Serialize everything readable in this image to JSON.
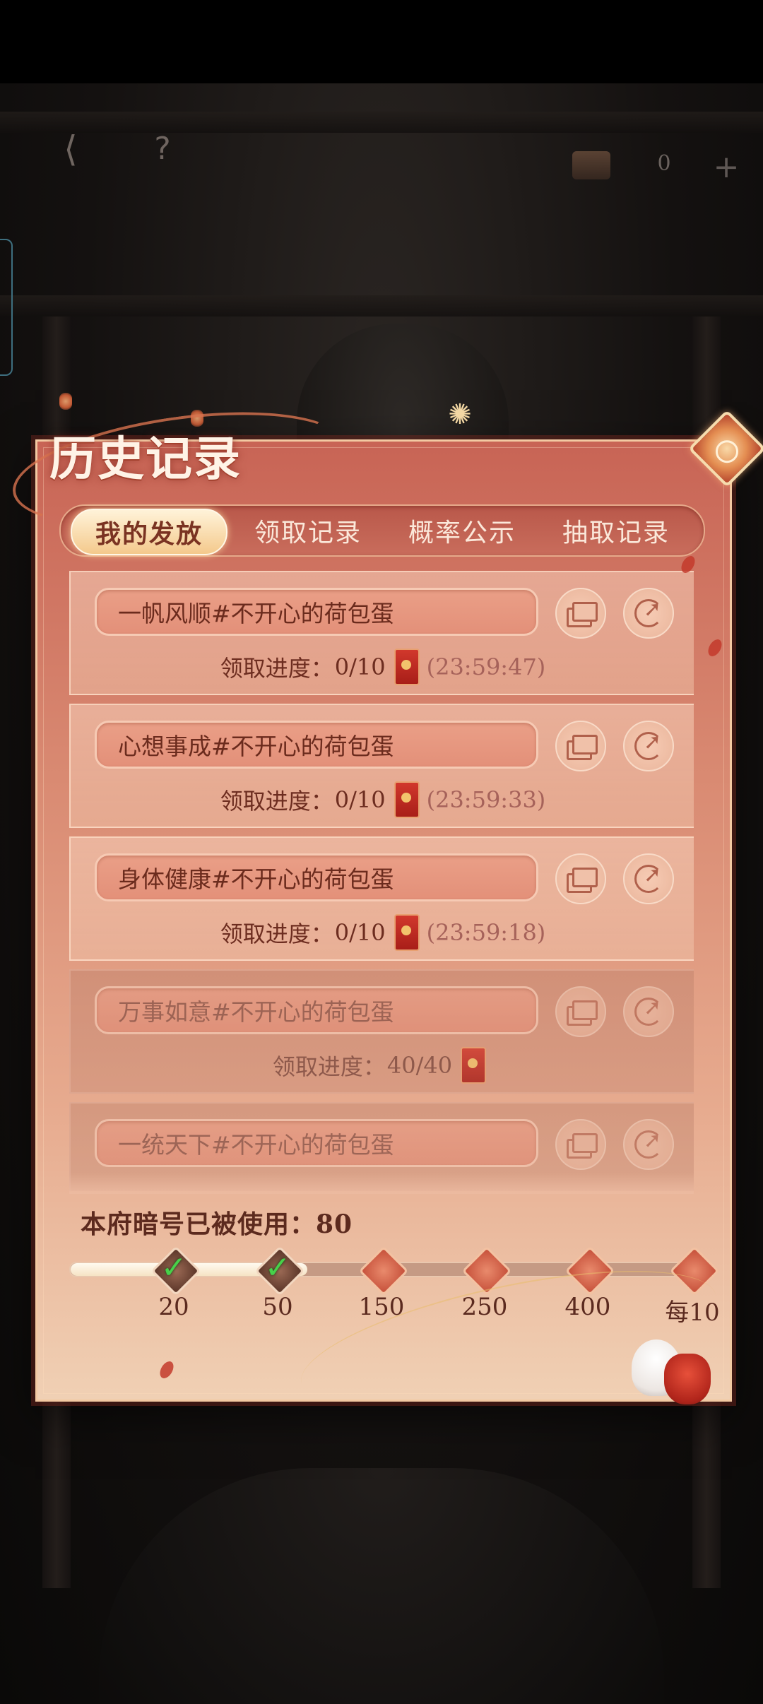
{
  "hud": {
    "back_icon": "back-arrow-icon",
    "help_label": "?",
    "currency_value": "0",
    "plus_label": "+"
  },
  "panel": {
    "title": "历史记录"
  },
  "tabs": [
    {
      "label": "我的发放",
      "active": true
    },
    {
      "label": "领取记录",
      "active": false
    },
    {
      "label": "概率公示",
      "active": false
    },
    {
      "label": "抽取记录",
      "active": false
    }
  ],
  "records": [
    {
      "name": "一帆风顺#不开心的荷包蛋",
      "progress_label": "领取进度：",
      "progress": "0/10",
      "timer": "(23:59:47)",
      "completed": false
    },
    {
      "name": "心想事成#不开心的荷包蛋",
      "progress_label": "领取进度：",
      "progress": "0/10",
      "timer": "(23:59:33)",
      "completed": false
    },
    {
      "name": "身体健康#不开心的荷包蛋",
      "progress_label": "领取进度：",
      "progress": "0/10",
      "timer": "(23:59:18)",
      "completed": false
    },
    {
      "name": "万事如意#不开心的荷包蛋",
      "progress_label": "领取进度：",
      "progress": "40/40",
      "timer": "",
      "completed": true
    },
    {
      "name": "一统天下#不开心的荷包蛋",
      "progress_label": "",
      "progress": "",
      "timer": "",
      "completed": true
    }
  ],
  "usage": {
    "text": "本府暗号已被使用：80",
    "progress_fraction": 0.37,
    "milestones": [
      {
        "label": "20",
        "reached": true
      },
      {
        "label": "50",
        "reached": true
      },
      {
        "label": "150",
        "reached": false
      },
      {
        "label": "250",
        "reached": false
      },
      {
        "label": "400",
        "reached": false
      },
      {
        "label": "每10",
        "reached": false
      }
    ]
  },
  "colors": {
    "panel_top": "#c86455",
    "panel_bottom": "#f0d0b4",
    "tab_active": "#f4c98c",
    "check_green": "#47d14a"
  }
}
